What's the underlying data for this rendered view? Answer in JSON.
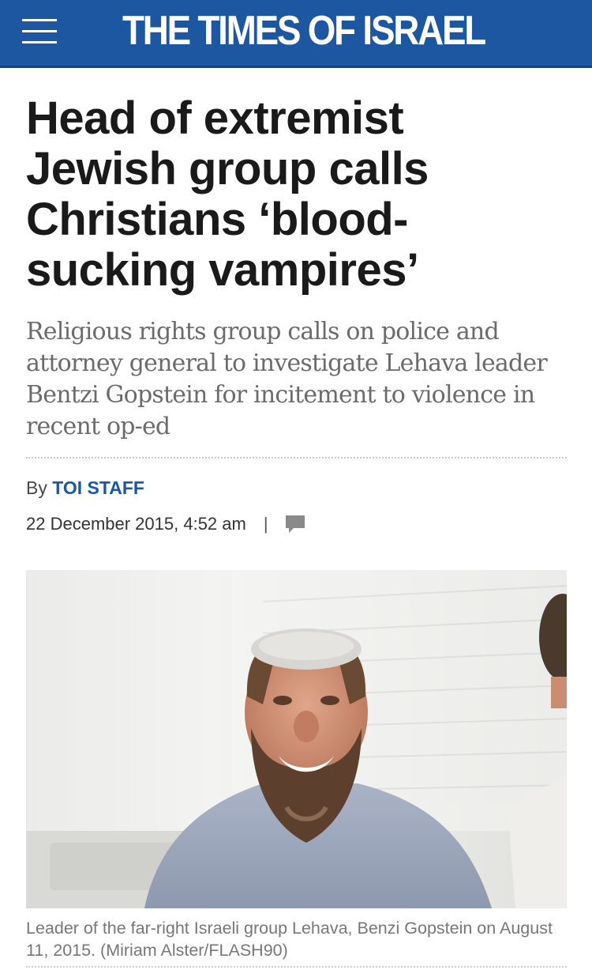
{
  "header": {
    "brand": "THE TIMES OF ISRAEL",
    "menu_icon": "hamburger-menu-icon",
    "background_color": "#1d56a1"
  },
  "article": {
    "headline": "Head of extremist Jewish group calls Christians ‘blood-sucking vampires’",
    "subheadline": "Religious rights group calls on police and attorney general to investigate Lehava leader Bentzi Gopstein for incitement to violence in recent op-ed",
    "byline_prefix": "By",
    "author": "TOI STAFF",
    "date": "22 December 2015, 4:52 am",
    "separator": "|",
    "comment_icon": "comment-bubble-icon",
    "photo_caption": "Leader of the far-right Israeli group Lehava, Benzi Gopstein on August 11, 2015. (Miriam Alster/FLASH90)"
  },
  "colors": {
    "link": "#1d56a1",
    "subhead": "#6b6b6b",
    "caption": "#777777"
  }
}
